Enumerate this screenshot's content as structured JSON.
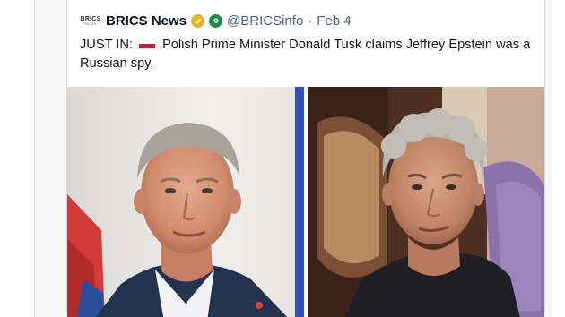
{
  "tweet": {
    "avatar_text": "BRICS",
    "avatar_subtext": "NEWS",
    "display_name": "BRICS News",
    "handle": "@BRICSinfo",
    "separator": "·",
    "date": "Feb 4",
    "text_prefix": "JUST IN:",
    "flag_icon": "poland-flag-icon",
    "text_body": "Polish Prime Minister Donald Tusk claims Jeffrey Epstein was a Russian spy.",
    "badges": [
      "gold-verified-badge-icon",
      "green-affiliate-badge-icon"
    ],
    "colors": {
      "text": "#0f1419",
      "secondary": "#536471",
      "gold_badge": "#e3b628",
      "green_badge": "#1f8a4c",
      "flag_red": "#dc143c"
    }
  },
  "media": {
    "images": [
      {
        "name": "photo-donald-tusk"
      },
      {
        "name": "photo-jeffrey-epstein"
      }
    ]
  }
}
